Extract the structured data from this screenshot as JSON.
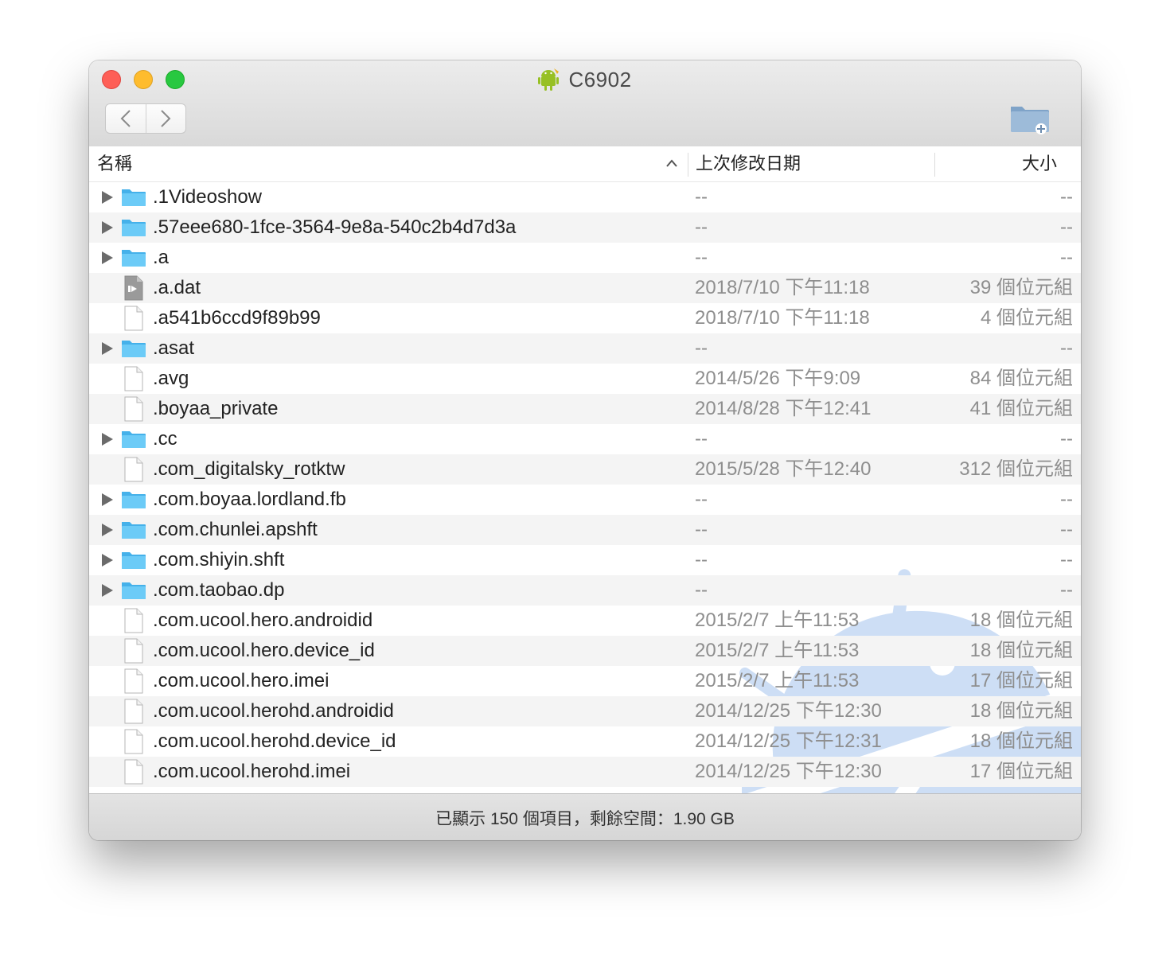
{
  "window": {
    "title": "C6902",
    "title_icon": "android-robot-icon"
  },
  "toolbar": {
    "back_icon": "chevron-left-icon",
    "forward_icon": "chevron-right-icon",
    "new_folder_icon": "new-folder-icon"
  },
  "columns": {
    "name": "名稱",
    "modified": "上次修改日期",
    "size": "大小"
  },
  "files": [
    {
      "name": ".1Videoshow",
      "kind": "folder",
      "modified": "--",
      "size": "--"
    },
    {
      "name": ".57eee680-1fce-3564-9e8a-540c2b4d7d3a",
      "kind": "folder",
      "modified": "--",
      "size": "--"
    },
    {
      "name": ".a",
      "kind": "folder",
      "modified": "--",
      "size": "--"
    },
    {
      "name": ".a.dat",
      "kind": "media",
      "modified": "2018/7/10 下午11:18",
      "size": "39 個位元組"
    },
    {
      "name": ".a541b6ccd9f89b99",
      "kind": "file",
      "modified": "2018/7/10 下午11:18",
      "size": "4 個位元組"
    },
    {
      "name": ".asat",
      "kind": "folder",
      "modified": "--",
      "size": "--"
    },
    {
      "name": ".avg",
      "kind": "file",
      "modified": "2014/5/26 下午9:09",
      "size": "84 個位元組"
    },
    {
      "name": ".boyaa_private",
      "kind": "file",
      "modified": "2014/8/28 下午12:41",
      "size": "41 個位元組"
    },
    {
      "name": ".cc",
      "kind": "folder",
      "modified": "--",
      "size": "--"
    },
    {
      "name": ".com_digitalsky_rotktw",
      "kind": "file",
      "modified": "2015/5/28 下午12:40",
      "size": "312 個位元組"
    },
    {
      "name": ".com.boyaa.lordland.fb",
      "kind": "folder",
      "modified": "--",
      "size": "--"
    },
    {
      "name": ".com.chunlei.apshft",
      "kind": "folder",
      "modified": "--",
      "size": "--"
    },
    {
      "name": ".com.shiyin.shft",
      "kind": "folder",
      "modified": "--",
      "size": "--"
    },
    {
      "name": ".com.taobao.dp",
      "kind": "folder",
      "modified": "--",
      "size": "--"
    },
    {
      "name": ".com.ucool.hero.androidid",
      "kind": "file",
      "modified": "2015/2/7 上午11:53",
      "size": "18 個位元組"
    },
    {
      "name": ".com.ucool.hero.device_id",
      "kind": "file",
      "modified": "2015/2/7 上午11:53",
      "size": "18 個位元組"
    },
    {
      "name": ".com.ucool.hero.imei",
      "kind": "file",
      "modified": "2015/2/7 上午11:53",
      "size": "17 個位元組"
    },
    {
      "name": ".com.ucool.herohd.androidid",
      "kind": "file",
      "modified": "2014/12/25 下午12:30",
      "size": "18 個位元組"
    },
    {
      "name": ".com.ucool.herohd.device_id",
      "kind": "file",
      "modified": "2014/12/25 下午12:31",
      "size": "18 個位元組"
    },
    {
      "name": ".com.ucool.herohd.imei",
      "kind": "file",
      "modified": "2014/12/25 下午12:30",
      "size": "17 個位元組"
    }
  ],
  "status": {
    "text": "已顯示 150 個項目，剩餘空間：1.90 GB"
  },
  "colors": {
    "folder": "#5ac8fa",
    "accent_watermark": "#1f6fd6"
  }
}
